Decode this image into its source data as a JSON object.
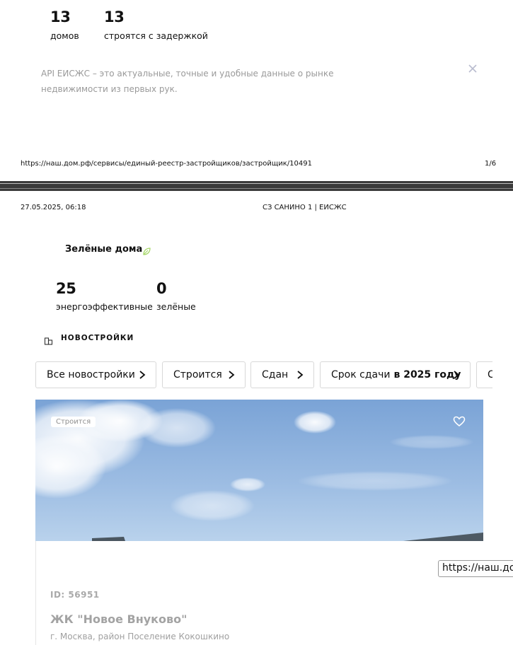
{
  "page1": {
    "stats": [
      {
        "value": "13",
        "label": "домов"
      },
      {
        "value": "13",
        "label": "строятся с задержкой"
      }
    ],
    "api_text": "API ЕИСЖС – это актуальные, точные и удобные данные о рынке недвижимости из первых рук.",
    "close_icon": "close-icon",
    "footer_url": "https://наш.дом.рф/сервисы/единый-реестр-застройщиков/застройщик/10491",
    "page_number": "1/6"
  },
  "page2": {
    "header_datetime": "27.05.2025, 06:18",
    "header_title": "СЗ САНИНО 1 | ЕИСЖС",
    "green_section": {
      "title": "Зелёные дома",
      "icon": "leaf-icon",
      "stats": [
        {
          "value": "25",
          "label": "энергоэффективные"
        },
        {
          "value": "0",
          "label": "зелёные"
        }
      ]
    },
    "novostroyki_label": "НОВОСТРОЙКИ",
    "filters": [
      {
        "label": "Все новостройки",
        "bold": ""
      },
      {
        "label": "Строится",
        "bold": ""
      },
      {
        "label": "Сдан",
        "bold": ""
      },
      {
        "label": "Срок сдачи",
        "bold": "в 2025 году"
      },
      {
        "label": "С",
        "bold": ""
      }
    ],
    "card": {
      "status": "Строится",
      "id": "ID: 56951",
      "name": "ЖК \"Новое Внуково\"",
      "address": "г. Москва, район Поселение Кокошкино"
    },
    "url_tooltip": "https://наш.дом"
  },
  "colors": {
    "separator": "#3a3a3a",
    "leaf_green": "#a8d86a",
    "sky_top": "#7aa3d6",
    "sky_bottom": "#b9d2ec"
  }
}
